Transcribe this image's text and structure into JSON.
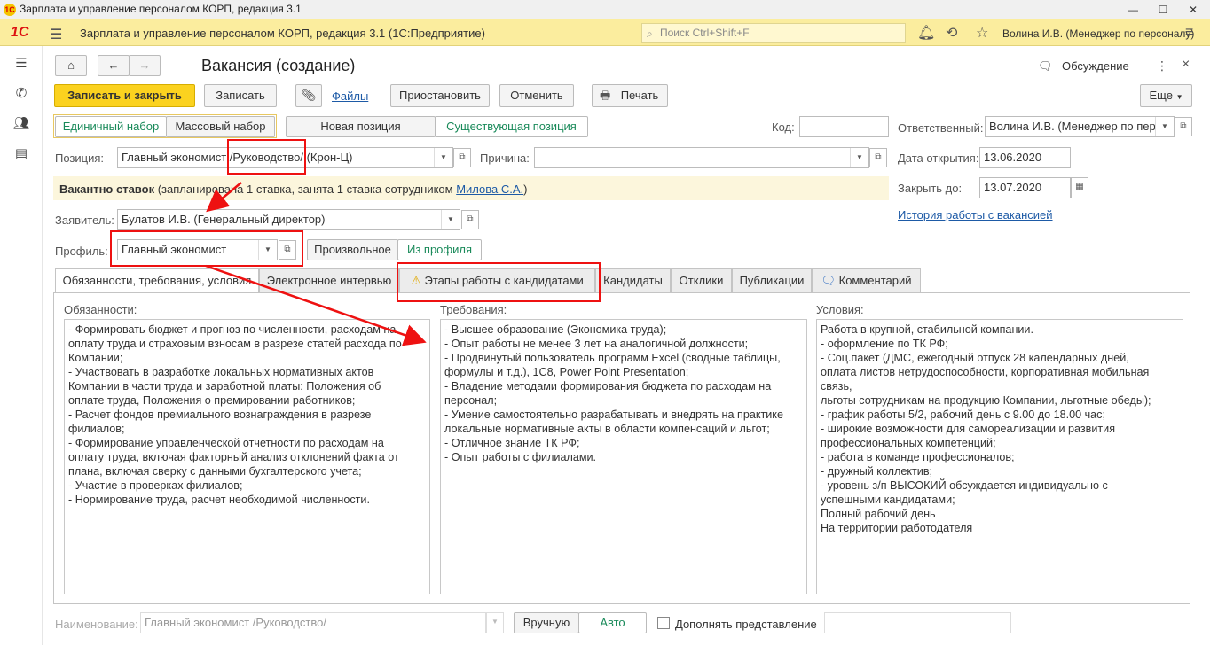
{
  "window": {
    "title": "Зарплата и управление персоналом КОРП, редакция 3.1",
    "minimize": "—",
    "maximize": "☐",
    "close": "✕"
  },
  "appbar": {
    "logo": "1С",
    "title": "Зарплата и управление персоналом КОРП, редакция 3.1  (1С:Предприятие)",
    "search_placeholder": "Поиск Ctrl+Shift+F",
    "user": "Волина И.В. (Менеджер по персоналу)"
  },
  "form": {
    "title": "Вакансия (создание)",
    "discussion": "Обсуждение",
    "close": "×",
    "more_icon": "⋮"
  },
  "toolbar": {
    "save_close": "Записать и закрыть",
    "save": "Записать",
    "files": "Файлы",
    "suspend": "Приостановить",
    "cancel": "Отменить",
    "print": "Печать",
    "more": "Еще"
  },
  "selection": {
    "single": "Единичный набор",
    "mass": "Массовый набор",
    "new_position": "Новая позиция",
    "existing_position": "Существующая позиция"
  },
  "fields": {
    "code_label": "Код:",
    "code_value": "",
    "position_label": "Позиция:",
    "position_value": "Главный экономист /Руководство/  (Крон-Ц)",
    "reason_label": "Причина:",
    "reason_value": "",
    "vacancy_bold": "Вакантно  ставок",
    "vacancy_text": "(запланирована 1 ставка, занята 1 ставка сотрудником",
    "vacancy_link": "Милова С.А.",
    "vacancy_tail": ")",
    "applicant_label": "Заявитель:",
    "applicant_value": "Булатов И.В. (Генеральный директор)",
    "profile_label": "Профиль:",
    "profile_value": "Главный экономист",
    "arbitrary": "Произвольное",
    "from_profile": "Из профиля",
    "responsible_label": "Ответственный:",
    "responsible_value": "Волина И.В. (Менеджер по пер",
    "open_date_label": "Дата открытия:",
    "open_date_value": "13.06.2020",
    "close_date_label": "Закрыть до:",
    "close_date_value": "13.07.2020",
    "history_link": "История работы с вакансией"
  },
  "tabs": [
    {
      "label": "Обязанности, требования, условия"
    },
    {
      "label": "Электронное интервью"
    },
    {
      "label": "Этапы работы с кандидатами"
    },
    {
      "label": "Кандидаты"
    },
    {
      "label": "Отклики"
    },
    {
      "label": "Публикации"
    },
    {
      "label": "Комментарий"
    }
  ],
  "panel": {
    "duties_label": "Обязанности:",
    "duties": [
      "- Формировать бюджет и прогноз по численности, расходам на",
      "оплату труда и страховым взносам в разрезе статей расхода по",
      "Компании;",
      "- Участвовать в разработке локальных нормативных актов",
      "Компании в части труда и заработной платы: Положения об",
      "оплате труда, Положения о премировании работников;",
      "- Расчет фондов премиального вознаграждения в разрезе",
      "филиалов;",
      "- Формирование управленческой отчетности по расходам на",
      "оплату труда, включая факторный анализ отклонений факта от",
      "плана, включая сверку с данными бухгалтерского учета;",
      "- Участие в проверках филиалов;",
      "- Нормирование труда, расчет необходимой численности."
    ],
    "requirements_label": "Требования:",
    "requirements": [
      "- Высшее образование (Экономика труда);",
      "- Опыт работы не менее 3 лет на аналогичной должности;",
      "- Продвинутый пользователь программ Excel (сводные таблицы,",
      "формулы и т.д.), 1С8, Power Point Presentation;",
      "- Владение методами формирования бюджета по расходам на",
      "персонал;",
      "- Умение самостоятельно разрабатывать и внедрять на практике",
      "локальные нормативные акты в области компенсаций и льгот;",
      "- Отличное знание ТК РФ;",
      "- Опыт работы с филиалами."
    ],
    "conditions_label": "Условия:",
    "conditions": [
      " Работа в крупной, стабильной компании.",
      "- оформление по ТК РФ;",
      "- Соц.пакет (ДМС, ежегодный отпуск 28 календарных дней,",
      "оплата листов нетрудоспособности, корпоративная мобильная",
      "связь,",
      "льготы сотрудникам на продукцию Компании, льготные обеды);",
      "- график работы 5/2, рабочий день с 9.00 до 18.00 час;",
      "- широкие возможности для самореализации и развития",
      "профессиональных компетенций;",
      "- работа в команде профессионалов;",
      "- дружный коллектив;",
      "- уровень з/п ВЫСОКИЙ обсуждается индивидуально с",
      "успешными кандидатами;",
      "Полный рабочий день",
      "На территории работодателя"
    ]
  },
  "footer": {
    "name_label": "Наименование:",
    "name_value": "Главный экономист /Руководство/",
    "manual": "Вручную",
    "auto": "Авто",
    "append_label": "Дополнять представление"
  },
  "colors": {
    "accent_yellow": "#fbd21f",
    "appbar": "#fbed9e",
    "link": "#1d5aa6",
    "green_toggle": "#1a8a5a",
    "annotation_red": "#e11111"
  }
}
